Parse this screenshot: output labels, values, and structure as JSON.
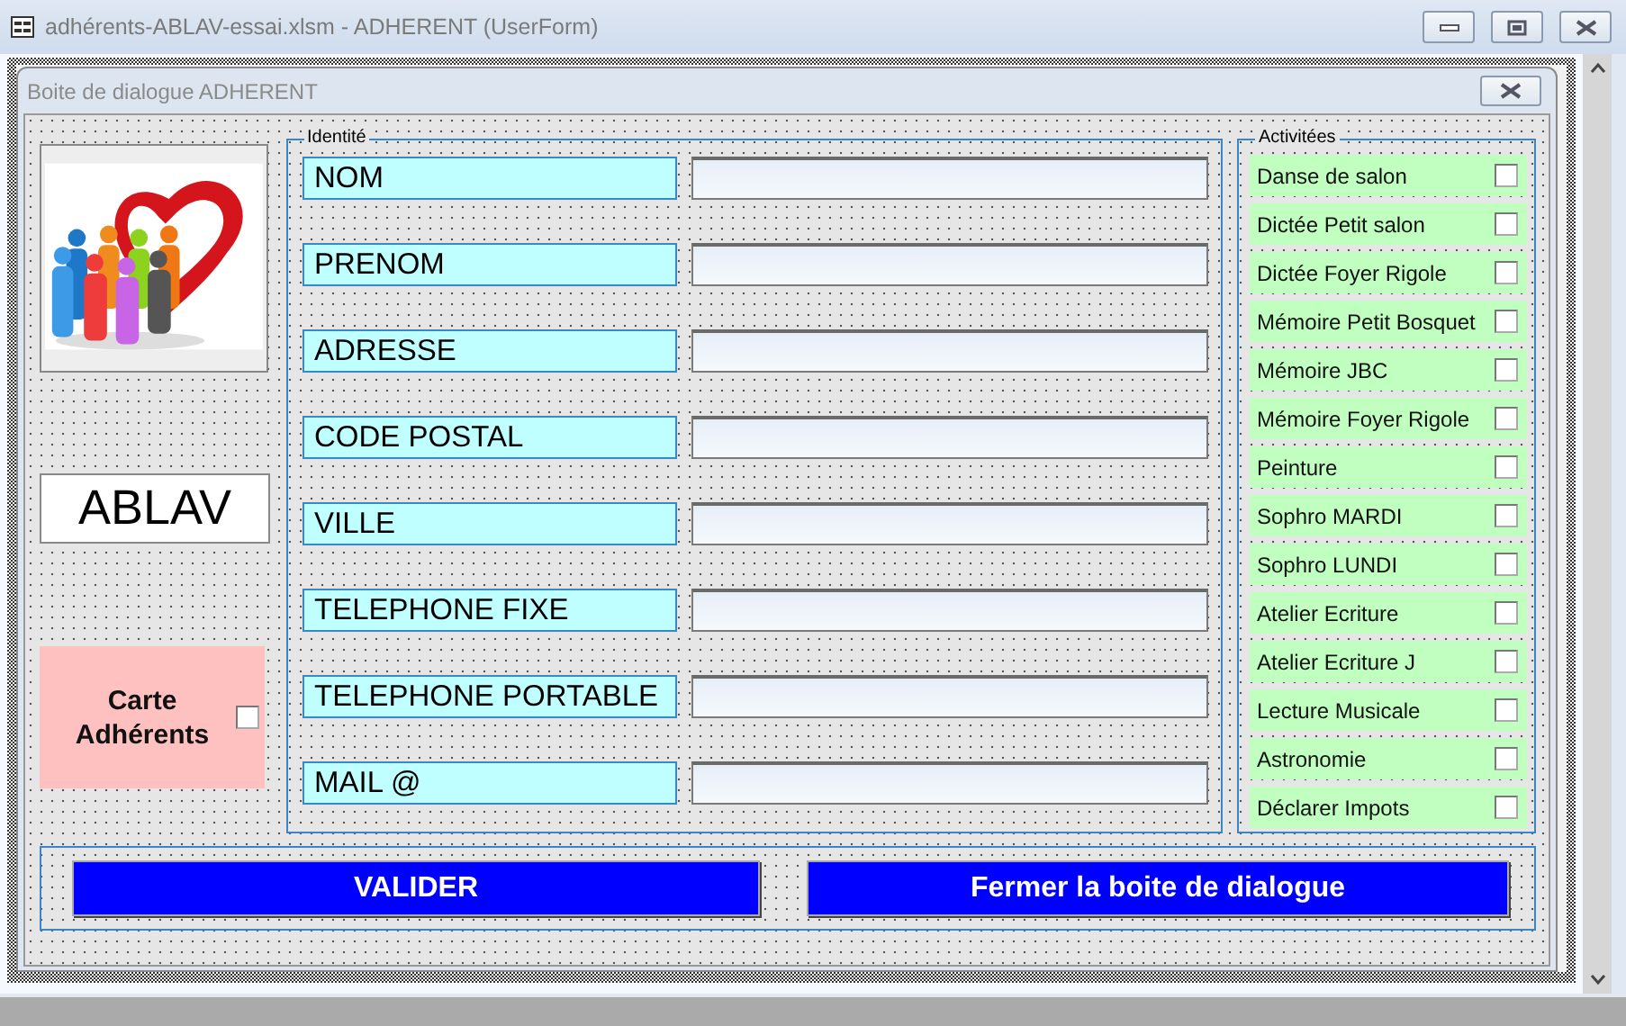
{
  "window": {
    "title": "adhérents-ABLAV-essai.xlsm - ADHERENT (UserForm)"
  },
  "dialog": {
    "title": "Boite de dialogue ADHERENT"
  },
  "org_name": "ABLAV",
  "member_card": {
    "label": "Carte Adhérents",
    "checked": false
  },
  "identity": {
    "legend": "Identité",
    "fields": [
      {
        "label": "NOM"
      },
      {
        "label": "PRENOM"
      },
      {
        "label": "ADRESSE"
      },
      {
        "label": "CODE POSTAL"
      },
      {
        "label": "VILLE"
      },
      {
        "label": "TELEPHONE FIXE"
      },
      {
        "label": "TELEPHONE PORTABLE"
      },
      {
        "label": "MAIL @"
      }
    ]
  },
  "activities": {
    "legend": "Activitées",
    "items": [
      {
        "label": "Danse de salon",
        "checked": false
      },
      {
        "label": "Dictée Petit salon",
        "checked": false
      },
      {
        "label": "Dictée Foyer Rigole",
        "checked": false
      },
      {
        "label": "Mémoire Petit Bosquet",
        "checked": false
      },
      {
        "label": "Mémoire JBC",
        "checked": false
      },
      {
        "label": "Mémoire Foyer Rigole",
        "checked": false
      },
      {
        "label": "Peinture",
        "checked": false
      },
      {
        "label": "Sophro MARDI",
        "checked": false
      },
      {
        "label": "Sophro LUNDI",
        "checked": false
      },
      {
        "label": "Atelier Ecriture",
        "checked": false
      },
      {
        "label": "Atelier Ecriture J",
        "checked": false
      },
      {
        "label": "Lecture Musicale",
        "checked": false
      },
      {
        "label": "Astronomie",
        "checked": false
      },
      {
        "label": "Déclarer Impots",
        "checked": false
      }
    ]
  },
  "buttons": [
    {
      "label": "VALIDER"
    },
    {
      "label": "Fermer la boite de dialogue"
    }
  ]
}
